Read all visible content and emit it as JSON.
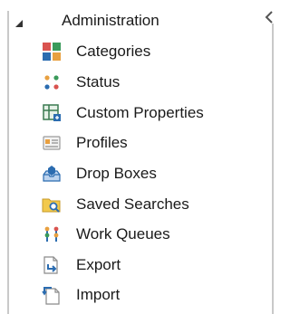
{
  "tree": {
    "header": {
      "label": "Administration",
      "expanded": true,
      "expander_icon": "expanded-triangle-icon"
    },
    "collapse_icon": "chevron-left-icon",
    "items": [
      {
        "label": "Categories",
        "icon": "categories-icon"
      },
      {
        "label": "Status",
        "icon": "status-icon"
      },
      {
        "label": "Custom Properties",
        "icon": "custom-properties-icon"
      },
      {
        "label": "Profiles",
        "icon": "profiles-icon"
      },
      {
        "label": "Drop Boxes",
        "icon": "drop-boxes-icon"
      },
      {
        "label": "Saved Searches",
        "icon": "saved-searches-icon"
      },
      {
        "label": "Work Queues",
        "icon": "work-queues-icon"
      },
      {
        "label": "Export",
        "icon": "export-icon"
      },
      {
        "label": "Import",
        "icon": "import-icon"
      }
    ]
  },
  "colors": {
    "border": "#c9c9c9",
    "text": "#1a1a1a",
    "accent_blue": "#2b6cb0",
    "accent_green": "#3a9a5a",
    "accent_orange": "#e8a040",
    "accent_red": "#d9534f",
    "accent_yellow": "#f2c94c"
  }
}
